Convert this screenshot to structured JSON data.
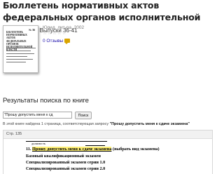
{
  "book": {
    "title": "Бюллетень нормативных актов федеральных органов исполнительной власти",
    "issues": "Выпуски 36-41",
    "meta": "Юрид. лит-ра, 2002",
    "stars": "☆☆☆☆☆",
    "reviews": "0 Отзывы",
    "cover": {
      "number": "№ 36",
      "title": "БЮЛЛЕТЕНЬ НОРМАТИВНЫХ АКТОВ ФЕДЕРАЛЬНЫХ ОРГАНОВ ИСПОЛНИТЕЛЬНОЙ ВЛАСТИ"
    }
  },
  "results": {
    "heading": "Результаты поиска по книге",
    "search_value": "\"Прошу допустить меня к сд",
    "search_button": "Поиск",
    "summary_prefix": "В этой книге найдена 1 страница, соответствующая запросу ",
    "summary_query": "\"Прошу допустить меня к сдаче экзамена\""
  },
  "snippet": {
    "page_label": "Стр. 135",
    "position_label": "должность",
    "main_prefix": "11. ",
    "highlight": "Прошу допустить меня к сдаче экзамена",
    "main_suffix": " (выбрать вид экзамена)",
    "lines": [
      "Базовый квалификационный экзамен",
      "Специализированный экзамен серии 1.0",
      "Специализированный экзамен серии 2.0"
    ]
  },
  "colors": {
    "highlight": "#fff176",
    "link": "#1a0dab",
    "review_icon": "#d9a400"
  }
}
